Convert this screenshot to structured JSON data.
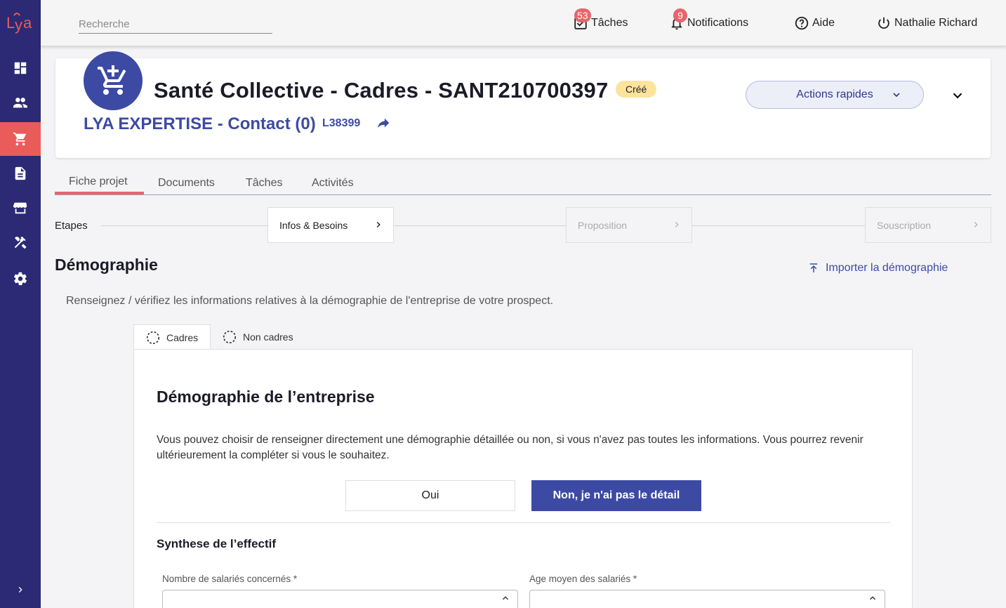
{
  "app": {
    "logo_text": "Lya"
  },
  "sidebar": {
    "items": [
      {
        "icon": "dashboard-icon",
        "active": false
      },
      {
        "icon": "users-icon",
        "active": false
      },
      {
        "icon": "cart-icon",
        "active": true
      },
      {
        "icon": "document-icon",
        "active": false
      },
      {
        "icon": "store-icon",
        "active": false
      },
      {
        "icon": "tools-icon",
        "active": false
      },
      {
        "icon": "gear-icon",
        "active": false
      }
    ],
    "expand_icon": "chevron-right-icon"
  },
  "topbar": {
    "search_placeholder": "Recherche",
    "tasks": {
      "label": "Tâches",
      "count": "53"
    },
    "notifications": {
      "label": "Notifications",
      "count": "9"
    },
    "help": {
      "label": "Aide"
    },
    "user": {
      "name": "Nathalie Richard"
    }
  },
  "header": {
    "title": "Santé Collective - Cadres - SANT210700397",
    "status": "Créé",
    "company": "LYA EXPERTISE - Contact (0)",
    "company_code": "L38399",
    "actions_label": "Actions rapides"
  },
  "tabs": [
    "Fiche projet",
    "Documents",
    "Tâches",
    "Activités"
  ],
  "steps": {
    "label": "Etapes",
    "items": [
      "Infos & Besoins",
      "Proposition",
      "Souscription"
    ]
  },
  "section": {
    "title": "Démographie",
    "import_label": "Importer la démographie",
    "description": "Renseignez / vérifiez les informations relatives à la démographie de l'entreprise de votre prospect."
  },
  "subtabs": [
    "Cadres",
    "Non cadres"
  ],
  "card": {
    "title": "Démographie de l’entreprise",
    "text": "Vous pouvez choisir de renseigner directement une démographie détaillée ou non, si vous n'avez pas toutes les informations. Vous pourrez revenir ultérieurement la compléter si vous le souhaitez.",
    "btn_yes": "Oui",
    "btn_no": "Non, je n'ai pas le détail",
    "subtitle": "Synthese de l’effectif",
    "field1_label": "Nombre de salariés concernés *",
    "field2_label": "Age moyen des salariés *"
  },
  "colors": {
    "sidebar": "#2c2a74",
    "accent": "#ea5c5a",
    "primary": "#3d4aa4",
    "status_badge": "#fde39c"
  }
}
